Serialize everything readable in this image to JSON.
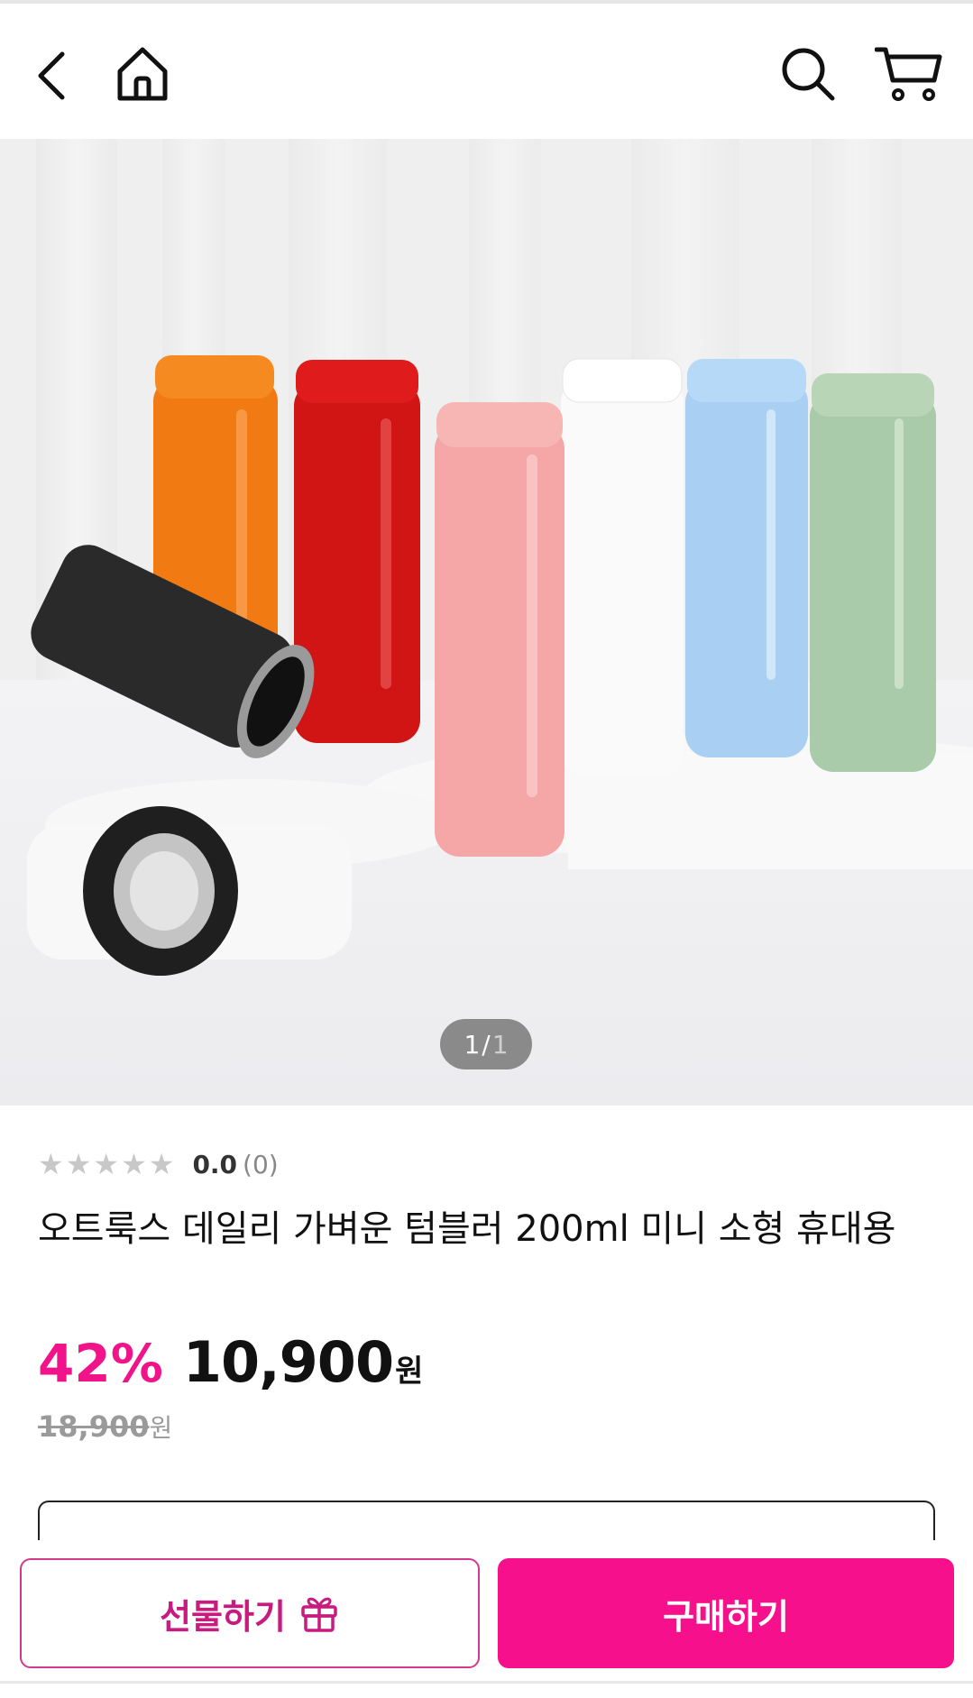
{
  "header": {
    "back_icon": "chevron-left-icon",
    "home_icon": "home-icon",
    "search_icon": "search-icon",
    "cart_icon": "cart-icon"
  },
  "gallery": {
    "current": "1",
    "separator": " / ",
    "total": "1"
  },
  "product": {
    "rating_score": "0.0",
    "rating_count": "(0)",
    "title": "오트룩스 데일리 가벼운 텀블러 200ml 미니 소형 휴대용",
    "discount": "42%",
    "price": "10,900",
    "price_unit": "원",
    "original_price": "18,900",
    "original_unit": "원"
  },
  "actions": {
    "gift_label": "선물하기",
    "buy_label": "구매하기"
  },
  "colors": {
    "accent": "#f7108b",
    "gift_text": "#c81b7f"
  }
}
